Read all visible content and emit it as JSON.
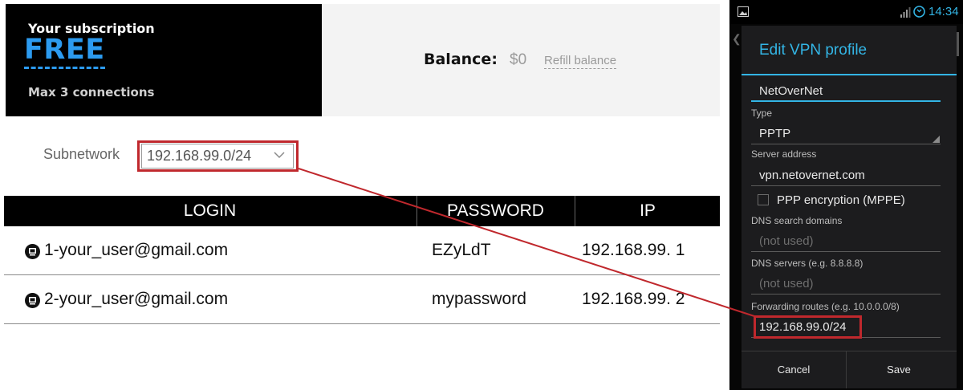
{
  "subscription": {
    "title": "Your subscription",
    "plan": "FREE",
    "connections": "Max 3 connections",
    "plan_color": "#2c9bf0"
  },
  "balance": {
    "label": "Balance:",
    "value": "$0",
    "refill_label": "Refill balance"
  },
  "subnetwork": {
    "label": "Subnetwork",
    "selected": "192.168.99.0/24",
    "icon": "chevron-down-icon"
  },
  "table": {
    "headers": {
      "login": "LOGIN",
      "password": "PASSWORD",
      "ip": "IP"
    },
    "rows": [
      {
        "login": "1-your_user@gmail.com",
        "password": "EZyLdT",
        "ip": "192.168.99. 1",
        "icon": "device-icon"
      },
      {
        "login": "2-your_user@gmail.com",
        "password": "mypassword",
        "ip": "192.168.99. 2",
        "icon": "device-icon"
      }
    ]
  },
  "android": {
    "status": {
      "time": "14:34",
      "icons": [
        "image-icon",
        "signal-icon",
        "sync-icon"
      ],
      "accent": "#33b5e5"
    },
    "dialog": {
      "title": "Edit VPN profile",
      "name_value": "NetOverNet",
      "type_label": "Type",
      "type_value": "PPTP",
      "server_label": "Server address",
      "server_value": "vpn.netovernet.com",
      "ppp_label": "PPP encryption (MPPE)",
      "ppp_checked": false,
      "dns_search_label": "DNS search domains",
      "dns_search_placeholder": "(not used)",
      "dns_servers_label": "DNS servers (e.g. 8.8.8.8)",
      "dns_servers_placeholder": "(not used)",
      "routes_label": "Forwarding routes (e.g. 10.0.0.0/8)",
      "routes_value": "192.168.99.0/24",
      "cancel_label": "Cancel",
      "save_label": "Save"
    }
  },
  "highlight_color": "#c0282d"
}
